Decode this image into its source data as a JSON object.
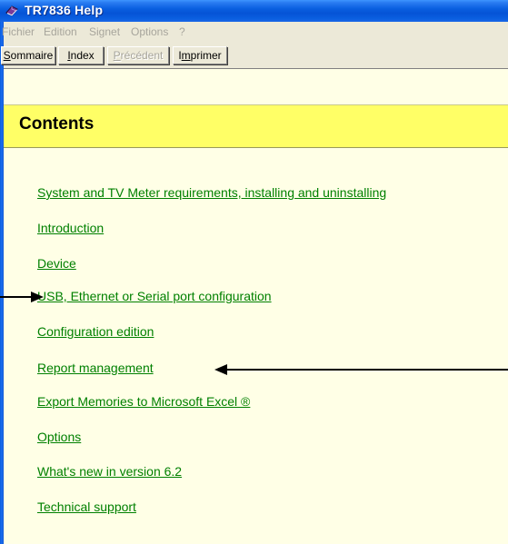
{
  "window": {
    "title": "TR7836 Help"
  },
  "menubar": {
    "items": [
      "Fichier",
      "Edition",
      "Signet",
      "Options",
      "?"
    ]
  },
  "toolbar": {
    "buttons": [
      {
        "prefix": "",
        "mnemonic": "S",
        "rest": "ommaire",
        "enabled": true
      },
      {
        "prefix": "",
        "mnemonic": "I",
        "rest": "ndex",
        "enabled": true
      },
      {
        "prefix": "",
        "mnemonic": "P",
        "rest": "récédent",
        "enabled": false
      },
      {
        "prefix": "I",
        "mnemonic": "m",
        "rest": "primer",
        "enabled": true
      }
    ]
  },
  "page": {
    "title": "Contents"
  },
  "toc": [
    "System and TV Meter requirements, installing and uninstalling",
    "Introduction",
    "Device",
    "USB, Ethernet or Serial port configuration",
    "Configuration edition",
    "Report management",
    "Export Memories to Microsoft Excel ®",
    "Options",
    "What's new in version 6.2",
    "Technical support"
  ],
  "colors": {
    "titlebar": "#0553d6",
    "header_band": "#ffff66",
    "content_bg": "#ffffe6",
    "link": "#008000"
  },
  "icons": {
    "app": "help-book-icon"
  }
}
